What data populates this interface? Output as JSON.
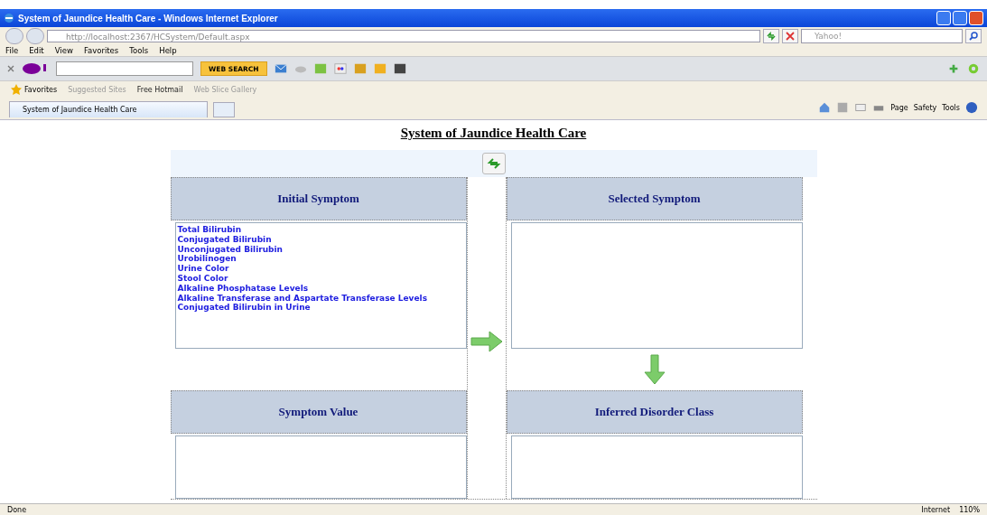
{
  "window": {
    "title": "System of Jaundice Health Care - Windows Internet Explorer"
  },
  "address_bar": {
    "value": "http://localhost:2367/HCSystem/Default.aspx"
  },
  "search": {
    "placeholder": "Yahoo!"
  },
  "menu": [
    "File",
    "Edit",
    "View",
    "Favorites",
    "Tools",
    "Help"
  ],
  "yahoo_toolbar": {
    "button": "WEB SEARCH"
  },
  "favorites_bar": {
    "label": "Favorites",
    "items": [
      "Suggested Sites",
      "Free Hotmail",
      "Web Slice Gallery"
    ]
  },
  "tabs": [
    {
      "label": "System of Jaundice Health Care",
      "selected": true
    }
  ],
  "command_bar": [
    "Page",
    "Safety",
    "Tools"
  ],
  "page": {
    "heading": "System of Jaundice Health Care",
    "panels": [
      "Initial Symptom",
      "Selected Symptom",
      "Symptom Value",
      "Inferred Disorder Class"
    ],
    "initial_symptoms": [
      "Total Bilirubin",
      "Conjugated Bilirubin",
      "Unconjugated Bilirubin",
      "Urobilinogen",
      "Urine Color",
      "Stool Color",
      "Alkaline Phosphatase Levels",
      "Alkaline Transferase and Aspartate Transferase Levels",
      "Conjugated Bilirubin in Urine"
    ]
  },
  "status_bar": {
    "status": "Done",
    "zone": "Internet",
    "zoom": "110%"
  }
}
